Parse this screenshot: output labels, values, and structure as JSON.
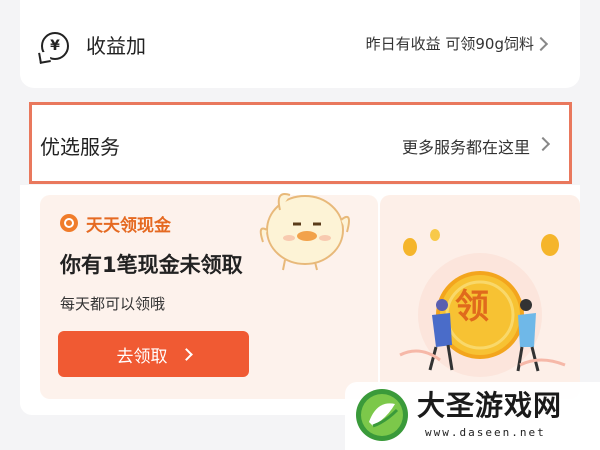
{
  "earnings_row": {
    "title": "收益加",
    "subtitle": "昨日有收益 可领90g饲料",
    "icon": "yuan-coin-icon"
  },
  "services_row": {
    "title": "优选服务",
    "more": "更多服务都在这里",
    "highlight_color": "#e9785d"
  },
  "promo": {
    "tag": "天天领现金",
    "heading": "你有1笔现金未领取",
    "description": "每天都可以领哦",
    "button_label": "去领取",
    "button_color": "#f05a33",
    "coin_character": "领"
  },
  "watermark": {
    "title": "大圣游戏网",
    "url": "www.daseen.net"
  }
}
